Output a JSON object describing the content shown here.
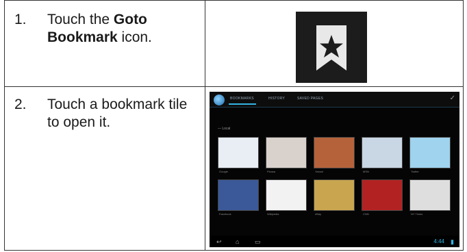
{
  "rows": [
    {
      "number": "1.",
      "pre": "Touch the ",
      "bold": "Goto Bookmark",
      "post": " icon."
    },
    {
      "number": "2.",
      "text": "Touch a bookmark tile to open it."
    }
  ],
  "icon": {
    "name": "bookmark-star-icon",
    "fg": "#e8e8e8",
    "bg": "#1c1c1c"
  },
  "tablet": {
    "tabs": [
      "BOOKMARKS",
      "HISTORY",
      "SAVED PAGES"
    ],
    "accent": "#33b5e5",
    "section": "Local",
    "tiles": [
      {
        "caption": "Google",
        "color": "#e9eef4"
      },
      {
        "caption": "Picasa",
        "color": "#d9d2cc"
      },
      {
        "caption": "Yahoo!",
        "color": "#b5623a"
      },
      {
        "caption": "MSN",
        "color": "#c9d6e3"
      },
      {
        "caption": "Twitter",
        "color": "#9fd3ee"
      },
      {
        "caption": "Facebook",
        "color": "#3b5998"
      },
      {
        "caption": "Wikipedia",
        "color": "#f2f2f2"
      },
      {
        "caption": "eBay",
        "color": "#c9a550"
      },
      {
        "caption": "CNN",
        "color": "#b22222"
      },
      {
        "caption": "NY Times",
        "color": "#dedede"
      }
    ],
    "clock": "4:44"
  }
}
